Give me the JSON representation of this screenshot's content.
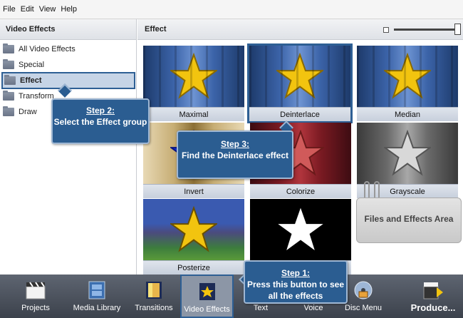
{
  "menu": [
    "File",
    "Edit",
    "View",
    "Help"
  ],
  "left_panel": {
    "title": "Video Effects",
    "items": [
      {
        "label": "All Video Effects",
        "selected": false
      },
      {
        "label": "Special",
        "selected": false
      },
      {
        "label": "Effect",
        "selected": true
      },
      {
        "label": "Transform",
        "selected": false
      },
      {
        "label": "Draw",
        "selected": false
      }
    ]
  },
  "effects_panel": {
    "title": "Effect",
    "tiles": [
      {
        "label": "Maximal",
        "style": "blue"
      },
      {
        "label": "Deinterlace",
        "style": "blue",
        "highlighted": true
      },
      {
        "label": "Median",
        "style": "blue"
      },
      {
        "label": "Invert",
        "style": "invert"
      },
      {
        "label": "Colorize",
        "style": "red"
      },
      {
        "label": "Grayscale",
        "style": "gray"
      },
      {
        "label": "Posterize",
        "style": "poster"
      },
      {
        "label": "",
        "style": "bw"
      }
    ],
    "files_area": "Files and Effects Area"
  },
  "callouts": {
    "step1": {
      "step": "Step 1:",
      "text": "Press this button to see all the effects"
    },
    "step2": {
      "step": "Step 2:",
      "text": "Select the Effect group"
    },
    "step3": {
      "step": "Step 3:",
      "text": "Find the Deinterlace effect"
    }
  },
  "taskbar": [
    {
      "label": "Projects",
      "icon": "clapper-icon"
    },
    {
      "label": "Media Library",
      "icon": "film-icon"
    },
    {
      "label": "Transitions",
      "icon": "transitions-icon"
    },
    {
      "label": "Video Effects",
      "icon": "star-icon",
      "active": true
    },
    {
      "label": "Text",
      "icon": "text-icon"
    },
    {
      "label": "Voice",
      "icon": "voice-icon"
    },
    {
      "label": "Disc Menu",
      "icon": "disc-icon"
    },
    {
      "label": "Produce...",
      "icon": "produce-icon"
    }
  ],
  "colors": {
    "accent": "#2b5d91",
    "star": "#f2c40f",
    "selection": "#c6d4e6"
  }
}
